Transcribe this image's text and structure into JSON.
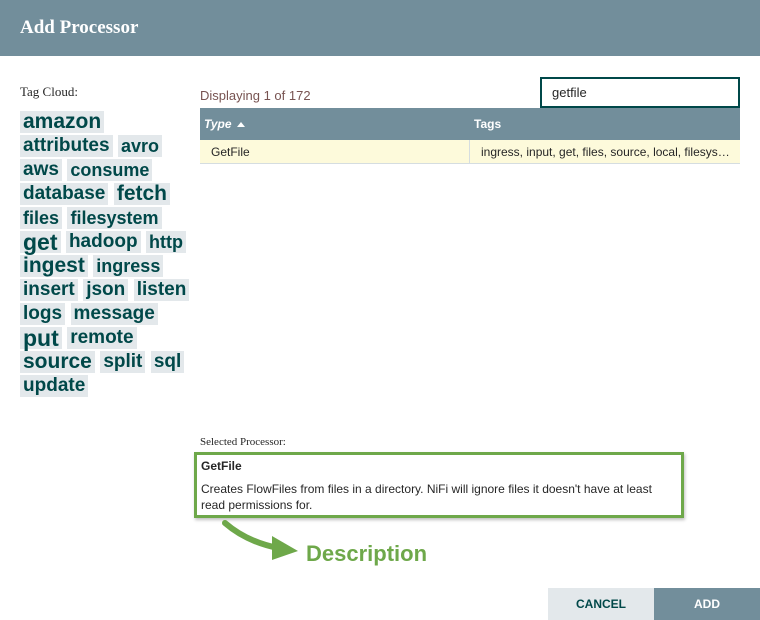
{
  "dialog": {
    "title": "Add Processor"
  },
  "tag_cloud": {
    "label": "Tag Cloud:",
    "tags": [
      {
        "label": "amazon",
        "size": 3
      },
      {
        "label": "attributes",
        "size": 2
      },
      {
        "label": "avro",
        "size": 1
      },
      {
        "label": "aws",
        "size": 2
      },
      {
        "label": "consume",
        "size": 1
      },
      {
        "label": "database",
        "size": 2
      },
      {
        "label": "fetch",
        "size": 3
      },
      {
        "label": "files",
        "size": 1
      },
      {
        "label": "filesystem",
        "size": 1
      },
      {
        "label": "get",
        "size": 4
      },
      {
        "label": "hadoop",
        "size": 2
      },
      {
        "label": "http",
        "size": 1
      },
      {
        "label": "ingest",
        "size": 3
      },
      {
        "label": "ingress",
        "size": 1
      },
      {
        "label": "insert",
        "size": 2
      },
      {
        "label": "json",
        "size": 2
      },
      {
        "label": "listen",
        "size": 2
      },
      {
        "label": "logs",
        "size": 2
      },
      {
        "label": "message",
        "size": 2
      },
      {
        "label": "put",
        "size": 4
      },
      {
        "label": "remote",
        "size": 2
      },
      {
        "label": "source",
        "size": 3
      },
      {
        "label": "split",
        "size": 2
      },
      {
        "label": "sql",
        "size": 2
      },
      {
        "label": "update",
        "size": 2
      }
    ]
  },
  "results": {
    "displaying": "Displaying 1 of 172"
  },
  "search": {
    "value": "getfile"
  },
  "table": {
    "columns": {
      "type": "Type",
      "tags": "Tags"
    },
    "rows": [
      {
        "type": "GetFile",
        "tags": "ingress, input, get, files, source, local, filesystem"
      }
    ]
  },
  "selected": {
    "label": "Selected Processor:",
    "name": "GetFile",
    "description": "Creates FlowFiles from files in a directory. NiFi will ignore files it doesn't have at least read permissions for."
  },
  "annotation": {
    "text": "Description",
    "color": "#6ea84a"
  },
  "buttons": {
    "cancel": "CANCEL",
    "add": "ADD"
  },
  "colors": {
    "header": "#728e9b",
    "tag_bg": "#e3e8eb",
    "tag_text": "#004849",
    "row_selected": "#fdfadb"
  }
}
